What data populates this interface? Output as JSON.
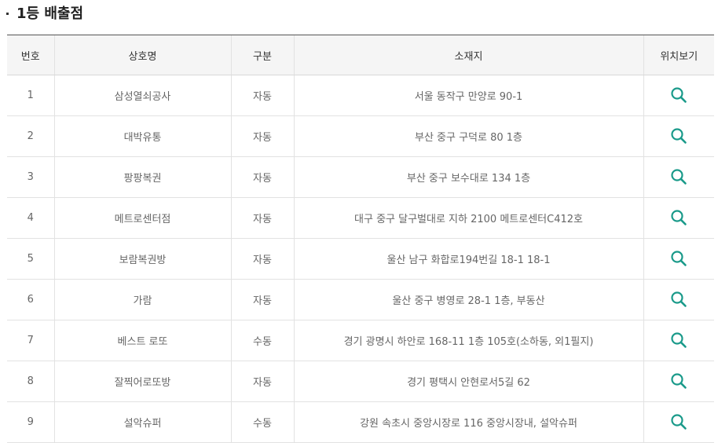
{
  "section": {
    "title": "1등 배출점"
  },
  "table": {
    "headers": [
      "번호",
      "상호명",
      "구분",
      "소재지",
      "위치보기"
    ],
    "rows": [
      {
        "no": "1",
        "name": "삼성열쇠공사",
        "type": "자동",
        "address": "서울 동작구 만양로 90-1"
      },
      {
        "no": "2",
        "name": "대박유통",
        "type": "자동",
        "address": "부산 중구 구덕로 80 1층"
      },
      {
        "no": "3",
        "name": "팡팡복권",
        "type": "자동",
        "address": "부산 중구 보수대로 134 1층"
      },
      {
        "no": "4",
        "name": "메트로센터점",
        "type": "자동",
        "address": "대구 중구 달구벌대로 지하 2100 메트로센터C412호"
      },
      {
        "no": "5",
        "name": "보람복권방",
        "type": "자동",
        "address": "울산 남구 화합로194번길 18-1 18-1"
      },
      {
        "no": "6",
        "name": "가람",
        "type": "자동",
        "address": "울산 중구 병영로 28-1 1층, 부동산"
      },
      {
        "no": "7",
        "name": "베스트 로또",
        "type": "수동",
        "address": "경기 광명시 하안로 168-11 1층 105호(소하동, 외1필지)"
      },
      {
        "no": "8",
        "name": "잘찍어로또방",
        "type": "자동",
        "address": "경기 평택시 안현로서5길 62"
      },
      {
        "no": "9",
        "name": "설악슈퍼",
        "type": "수동",
        "address": "강원 속초시 중앙시장로 116 중앙시장내, 설악슈퍼"
      }
    ]
  },
  "icons": {
    "location": "search-icon"
  },
  "colors": {
    "accent": "#1a9a8a",
    "header_bg": "#f5f5f5"
  }
}
